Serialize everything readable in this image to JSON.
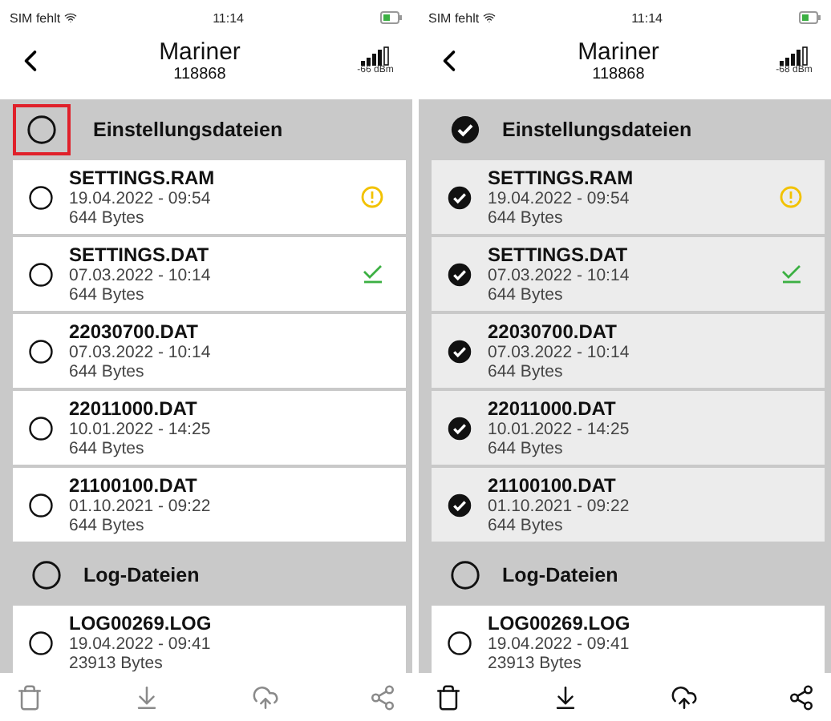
{
  "screens": [
    {
      "status_bar": {
        "carrier": "SIM fehlt",
        "time": "11:14"
      },
      "nav": {
        "title": "Mariner",
        "subtitle": "118868",
        "signal": "-66 dBm"
      },
      "sections": [
        {
          "title": "Einstellungsdateien",
          "selected": false,
          "highlighted": true,
          "files": [
            {
              "kind": "warning",
              "name": "SETTINGS.RAM",
              "date": "19.04.2022 - 09:54",
              "size": "644 Bytes",
              "selected": false
            },
            {
              "kind": "synced",
              "name": "SETTINGS.DAT",
              "date": "07.03.2022 - 10:14",
              "size": "644 Bytes",
              "selected": false
            },
            {
              "kind": "plain",
              "name": "22030700.DAT",
              "date": "07.03.2022 - 10:14",
              "size": "644 Bytes",
              "selected": false
            },
            {
              "kind": "plain",
              "name": "22011000.DAT",
              "date": "10.01.2022 - 14:25",
              "size": "644 Bytes",
              "selected": false
            },
            {
              "kind": "plain",
              "name": "21100100.DAT",
              "date": "01.10.2021 - 09:22",
              "size": "644 Bytes",
              "selected": false
            }
          ]
        },
        {
          "title": "Log-Dateien",
          "selected": false,
          "files": [
            {
              "kind": "plain",
              "name": "LOG00269.LOG",
              "date": "19.04.2022 - 09:41",
              "size": "23913 Bytes",
              "selected": false
            }
          ]
        }
      ],
      "toolbar": {
        "disabled": true
      }
    },
    {
      "status_bar": {
        "carrier": "SIM fehlt",
        "time": "11:14"
      },
      "nav": {
        "title": "Mariner",
        "subtitle": "118868",
        "signal": "-68 dBm"
      },
      "sections": [
        {
          "title": "Einstellungsdateien",
          "selected": true,
          "files": [
            {
              "kind": "warning",
              "name": "SETTINGS.RAM",
              "date": "19.04.2022 - 09:54",
              "size": "644 Bytes",
              "selected": true
            },
            {
              "kind": "synced",
              "name": "SETTINGS.DAT",
              "date": "07.03.2022 - 10:14",
              "size": "644 Bytes",
              "selected": true
            },
            {
              "kind": "plain",
              "name": "22030700.DAT",
              "date": "07.03.2022 - 10:14",
              "size": "644 Bytes",
              "selected": true
            },
            {
              "kind": "plain",
              "name": "22011000.DAT",
              "date": "10.01.2022 - 14:25",
              "size": "644 Bytes",
              "selected": true
            },
            {
              "kind": "plain",
              "name": "21100100.DAT",
              "date": "01.10.2021 - 09:22",
              "size": "644 Bytes",
              "selected": true
            }
          ]
        },
        {
          "title": "Log-Dateien",
          "selected": false,
          "files": [
            {
              "kind": "plain",
              "name": "LOG00269.LOG",
              "date": "19.04.2022 - 09:41",
              "size": "23913 Bytes",
              "selected": false
            }
          ]
        }
      ],
      "toolbar": {
        "disabled": false
      }
    }
  ]
}
